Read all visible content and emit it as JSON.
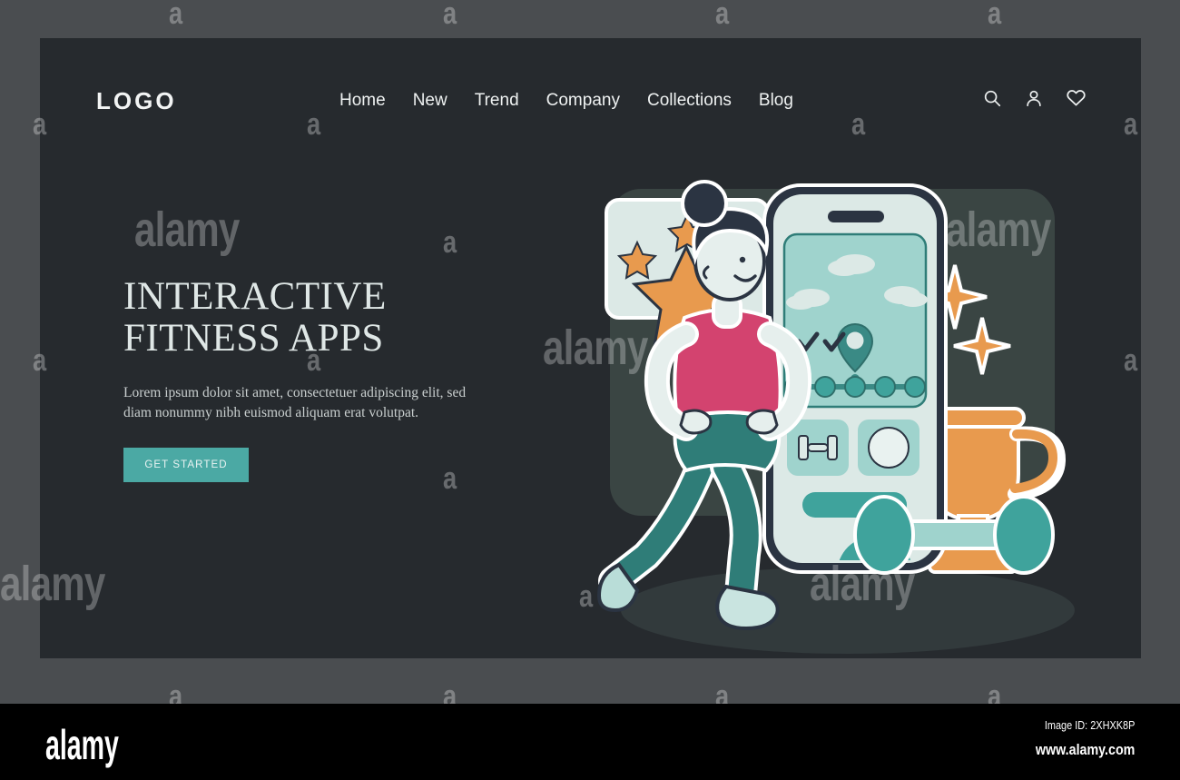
{
  "footer": {
    "brand": "alamy",
    "image_id": "Image ID: 2XHXK8P",
    "url": "www.alamy.com"
  },
  "watermark": {
    "big": "alamy",
    "small": "a"
  },
  "header": {
    "logo": "LOGO",
    "nav": [
      {
        "label": "Home"
      },
      {
        "label": "New"
      },
      {
        "label": "Trend"
      },
      {
        "label": "Company"
      },
      {
        "label": "Collections"
      },
      {
        "label": "Blog"
      }
    ],
    "icons": [
      {
        "name": "search-icon"
      },
      {
        "name": "user-icon"
      },
      {
        "name": "heart-icon"
      }
    ]
  },
  "hero": {
    "headline_line1": "INTERACTIVE",
    "headline_line2": "FITNESS APPS",
    "subcopy": "Lorem ipsum dolor sit amet, consectetuer adipiscing elit, sed diam nonummy nibh euismod aliquam erat volutpat.",
    "cta_label": "GET STARTED"
  },
  "illustration": {
    "title": "Fitness app hero illustration",
    "phone": {
      "screen_card": "map-progress-card",
      "checkmarks": 2,
      "progress_dots": 5,
      "tiles": [
        "dumbbell-tile",
        "circle-tile"
      ],
      "pill_button": "primary-pill-button"
    },
    "speech_bubble": {
      "stars": 4
    },
    "sparkles": 2,
    "props": [
      "trophy",
      "dumbbell",
      "runner-character"
    ]
  },
  "colors": {
    "page_bg": "#262a2e",
    "outer_bg": "#4a4d50",
    "accent_teal": "#4ba9a4",
    "accent_orange": "#e89a4e",
    "accent_pink": "#d3436f",
    "panel_dark": "#3a4543",
    "mint_light": "#dce9e6",
    "mint_mid": "#9fd3cd",
    "ink": "#2b3442",
    "text_light": "#dfe7e6"
  }
}
